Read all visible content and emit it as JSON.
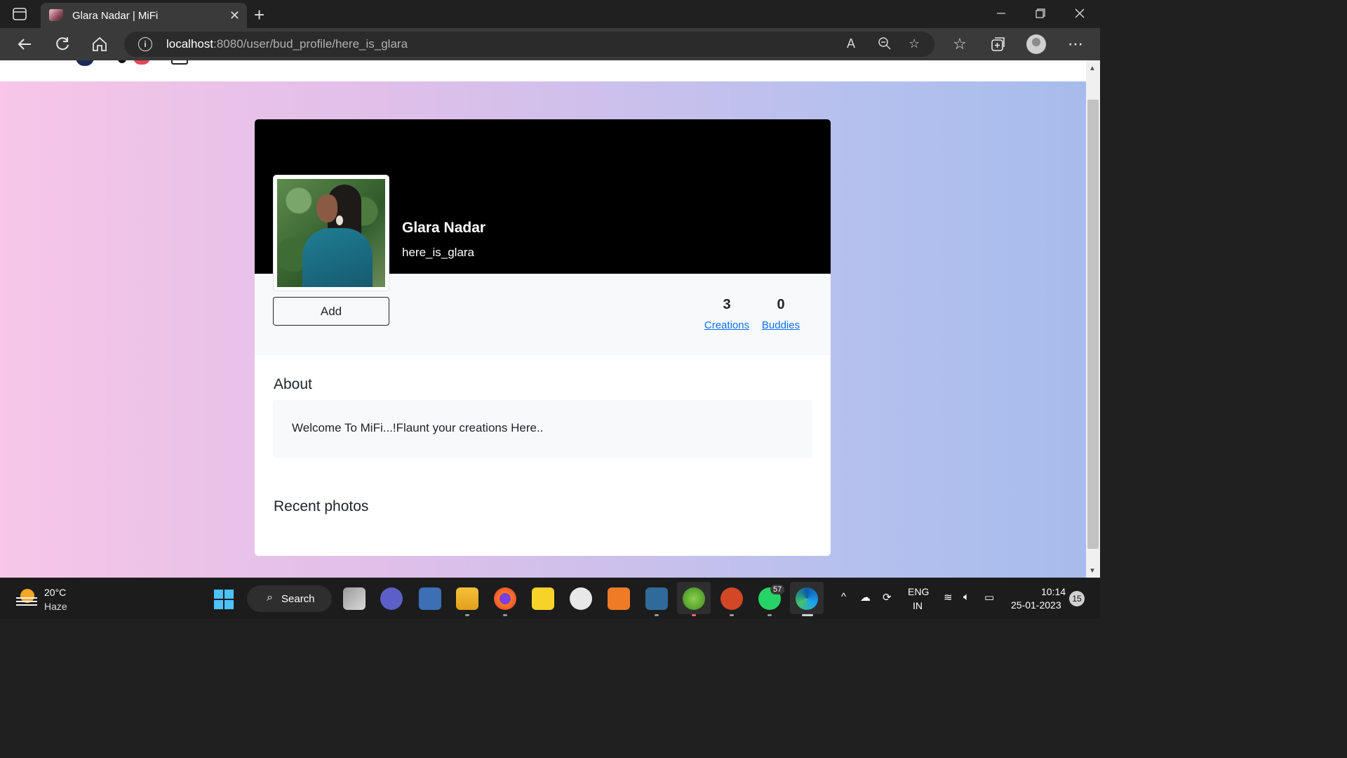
{
  "browser": {
    "tab_title": "Glara Nadar | MiFi",
    "tab_close": "✕",
    "new_tab": "+",
    "url_host": "localhost",
    "url_rest": ":8080/user/bud_profile/here_is_glara"
  },
  "profile": {
    "name": "Glara Nadar",
    "handle": "here_is_glara",
    "add_label": "Add",
    "stats": [
      {
        "value": "3",
        "label": "Creations"
      },
      {
        "value": "0",
        "label": "Buddies"
      }
    ],
    "about_heading": "About",
    "about_text": "Welcome To MiFi...!Flaunt your creations Here..",
    "recent_heading": "Recent photos"
  },
  "taskbar": {
    "temperature": "20°C",
    "condition": "Haze",
    "search_label": "Search",
    "whatsapp_badge": "57",
    "lang_line1": "ENG",
    "lang_line2": "IN",
    "time": "10:14",
    "date": "25-01-2023",
    "notification_count": "15"
  },
  "colors": {
    "link": "#0d6efd",
    "cover": "#000000",
    "gradient_left": "#f7c6e8",
    "gradient_right": "#a7bcec"
  }
}
